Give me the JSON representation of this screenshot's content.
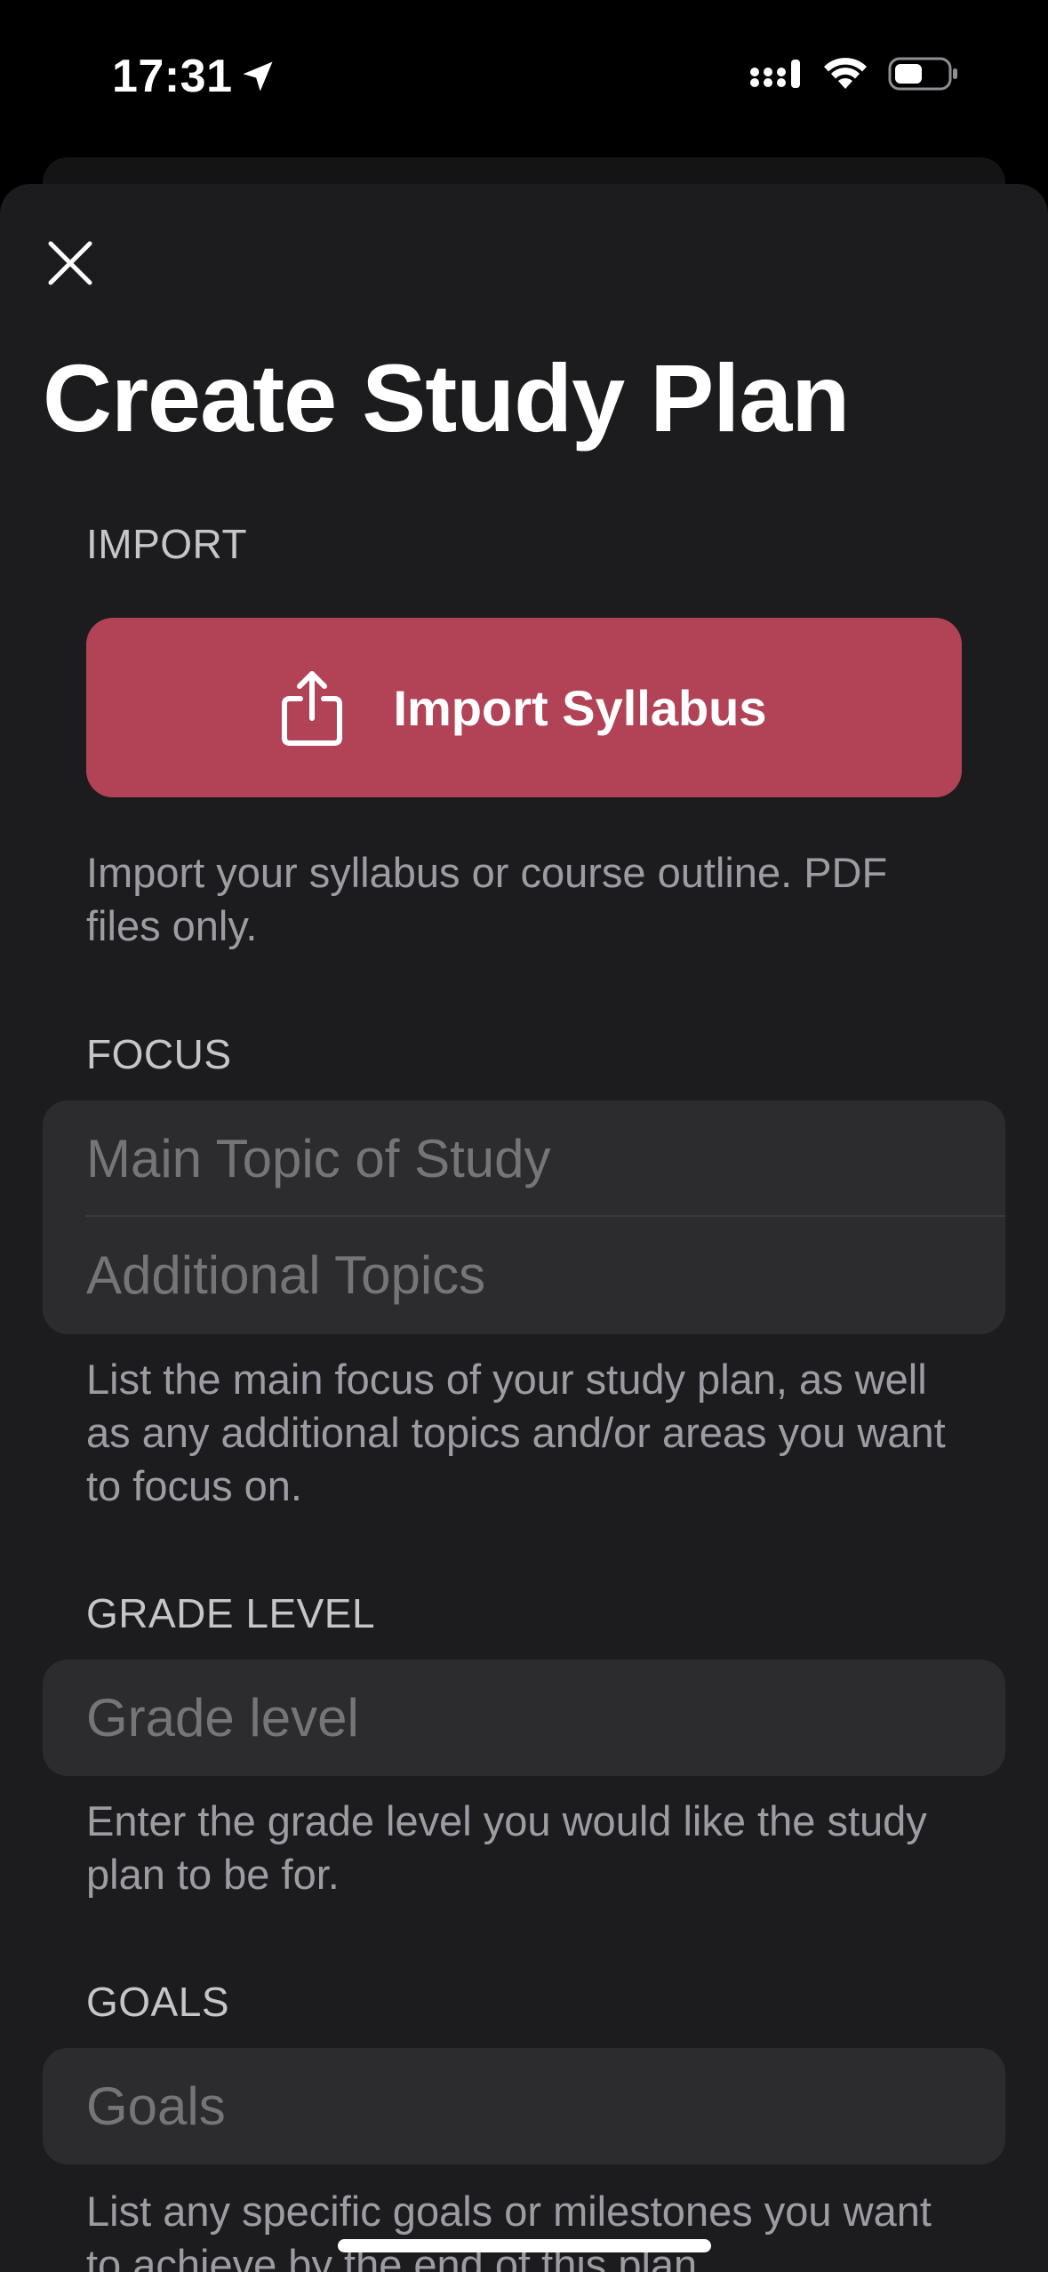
{
  "status_bar": {
    "time": "17:31",
    "icons": [
      "location-arrow-icon",
      "cellular-signal-icon",
      "wifi-icon",
      "battery-icon"
    ]
  },
  "sheet": {
    "close_icon": "close-icon",
    "title": "Create Study Plan"
  },
  "import": {
    "header": "IMPORT",
    "button_label": "Import Syllabus",
    "button_icon": "share-upload-icon",
    "button_color": "#b24256",
    "footer": "Import your syllabus or course outline. PDF files only."
  },
  "focus": {
    "header": "FOCUS",
    "main_topic_placeholder": "Main Topic of Study",
    "additional_topics_placeholder": "Additional Topics",
    "footer": "List the main focus of your study plan, as well as any additional topics and/or areas you want to focus on."
  },
  "grade_level": {
    "header": "GRADE LEVEL",
    "placeholder": "Grade level",
    "footer": "Enter the grade level you would like the study plan to be for."
  },
  "goals": {
    "header": "GOALS",
    "placeholder": "Goals",
    "footer": "List any specific goals or milestones you want to achieve by the end of this plan."
  },
  "colors": {
    "background": "#000000",
    "sheet": "#1c1c1e",
    "field": "#2c2c2e",
    "accent": "#b24256"
  }
}
